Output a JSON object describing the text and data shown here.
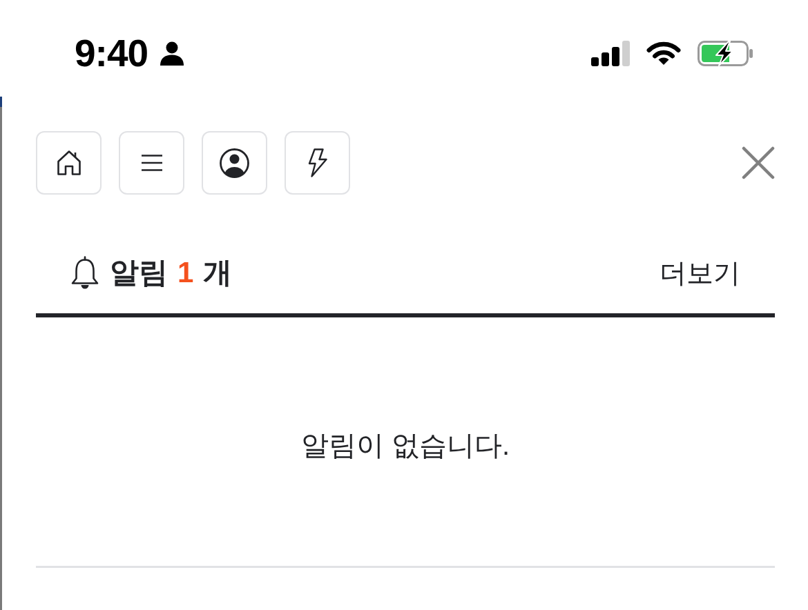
{
  "status_bar": {
    "time": "9:40"
  },
  "notifications": {
    "title": "알림",
    "count": "1",
    "unit": "개",
    "more_link": "더보기",
    "empty_message": "알림이 없습니다."
  }
}
